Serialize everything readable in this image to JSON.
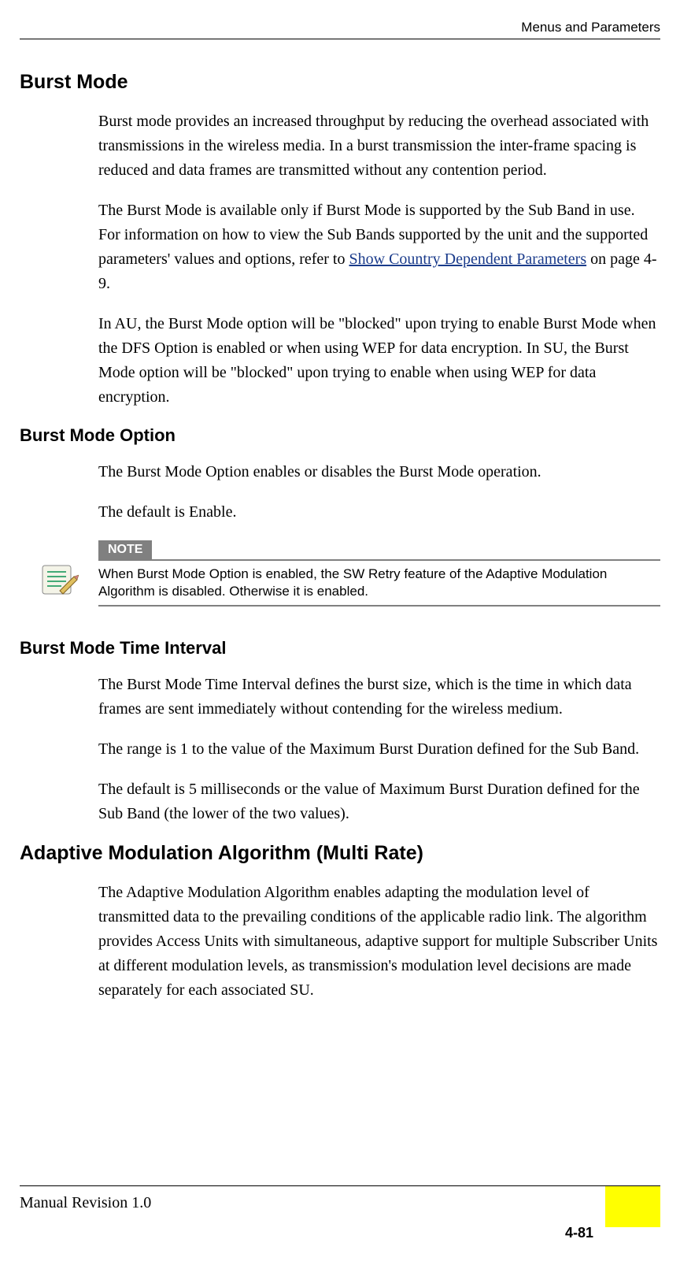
{
  "header": {
    "running": "Menus and Parameters"
  },
  "sections": {
    "burst_mode": {
      "title": "Burst Mode",
      "p1": "Burst mode provides an increased throughput by reducing the overhead associated with transmissions in the wireless media. In a burst transmission the inter-frame spacing is reduced and data frames are transmitted without any contention period.",
      "p2a": "The Burst Mode is available only if Burst Mode is supported by the Sub Band in use. For information on how to view the Sub Bands supported by the unit and the supported parameters' values and options, refer to ",
      "p2_link": "Show Country Dependent Parameters",
      "p2b": " on page 4-9.",
      "p3": "In AU, the Burst Mode option will be \"blocked\" upon trying to enable Burst Mode when the DFS Option is enabled or when using WEP for data encryption. In SU, the Burst Mode option will be \"blocked\" upon trying to enable when using WEP for data encryption."
    },
    "burst_mode_option": {
      "title": "Burst Mode Option",
      "p1": "The Burst Mode Option enables or disables the Burst Mode operation.",
      "p2": "The default is Enable."
    },
    "note": {
      "label": "NOTE",
      "text": "When Burst Mode Option is enabled, the SW Retry feature of the Adaptive Modulation Algorithm is disabled. Otherwise it is enabled."
    },
    "burst_mode_time": {
      "title": "Burst Mode Time Interval",
      "p1": "The Burst Mode Time Interval defines the burst size, which is the time in which data frames are sent immediately without contending for the wireless medium.",
      "p2": "The range is 1 to the value of the Maximum Burst Duration defined for the Sub Band.",
      "p3": "The default is 5 milliseconds or the value of Maximum Burst Duration defined for the Sub Band (the lower of the two values)."
    },
    "adaptive": {
      "title": "Adaptive Modulation Algorithm (Multi Rate)",
      "p1": "The Adaptive Modulation Algorithm enables adapting the modulation level of transmitted data to the prevailing conditions of the applicable radio link. The algorithm provides Access Units with simultaneous, adaptive support for multiple Subscriber Units at different modulation levels, as transmission's modulation level decisions are made separately for each associated SU."
    }
  },
  "footer": {
    "left": "Manual Revision 1.0",
    "page": "4-81"
  }
}
